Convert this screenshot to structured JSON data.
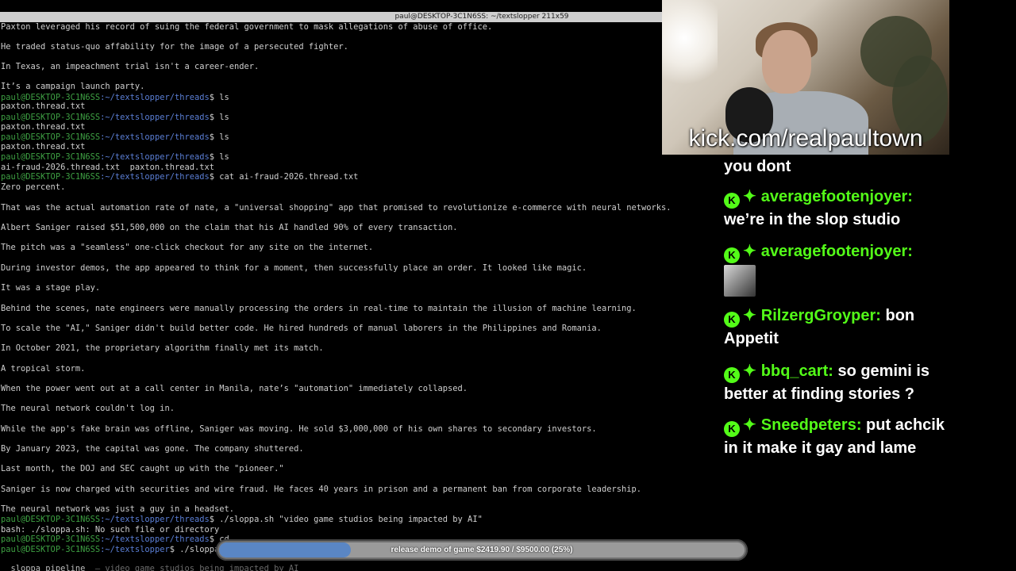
{
  "window": {
    "title": "paul@DESKTOP-3C1N6SS: ~/textslopper 211x59"
  },
  "terminal": {
    "prompt_user": "paul@DESKTOP-3C1N6SS",
    "lines": [
      {
        "type": "text",
        "text": "Paxton leveraged his record of suing the federal government to mask allegations of abuse of office."
      },
      {
        "type": "text",
        "text": "He traded status-quo affability for the image of a persecuted fighter."
      },
      {
        "type": "text",
        "text": "In Texas, an impeachment trial isn't a career-ender."
      },
      {
        "type": "text",
        "text": "It’s a campaign launch party."
      },
      {
        "type": "prompt",
        "path": ":~/textslopper/threads",
        "cmd": "$ ls"
      },
      {
        "type": "text",
        "text": "paxton.thread.txt"
      },
      {
        "type": "prompt",
        "path": ":~/textslopper/threads",
        "cmd": "$ ls"
      },
      {
        "type": "text",
        "text": "paxton.thread.txt"
      },
      {
        "type": "prompt",
        "path": ":~/textslopper/threads",
        "cmd": "$ ls"
      },
      {
        "type": "text",
        "text": "paxton.thread.txt"
      },
      {
        "type": "prompt",
        "path": ":~/textslopper/threads",
        "cmd": "$ ls"
      },
      {
        "type": "text",
        "text": "ai-fraud-2026.thread.txt  paxton.thread.txt"
      },
      {
        "type": "prompt",
        "path": ":~/textslopper/threads",
        "cmd": "$ cat ai-fraud-2026.thread.txt"
      },
      {
        "type": "text",
        "text": "Zero percent."
      },
      {
        "type": "text",
        "text": "That was the actual automation rate of nate, a \"universal shopping\" app that promised to revolutionize e-commerce with neural networks."
      },
      {
        "type": "text",
        "text": "Albert Saniger raised $51,500,000 on the claim that his AI handled 90% of every transaction."
      },
      {
        "type": "text",
        "text": "The pitch was a \"seamless\" one-click checkout for any site on the internet."
      },
      {
        "type": "text",
        "text": "During investor demos, the app appeared to think for a moment, then successfully place an order. It looked like magic."
      },
      {
        "type": "text",
        "text": "It was a stage play."
      },
      {
        "type": "text",
        "text": "Behind the scenes, nate engineers were manually processing the orders in real-time to maintain the illusion of machine learning."
      },
      {
        "type": "text",
        "text": "To scale the \"AI,\" Saniger didn't build better code. He hired hundreds of manual laborers in the Philippines and Romania."
      },
      {
        "type": "text",
        "text": "In October 2021, the proprietary algorithm finally met its match."
      },
      {
        "type": "text",
        "text": "A tropical storm."
      },
      {
        "type": "text",
        "text": "When the power went out at a call center in Manila, nate’s \"automation\" immediately collapsed."
      },
      {
        "type": "text",
        "text": "The neural network couldn't log in."
      },
      {
        "type": "text",
        "text": "While the app's fake brain was offline, Saniger was moving. He sold $3,000,000 of his own shares to secondary investors."
      },
      {
        "type": "text",
        "text": "By January 2023, the capital was gone. The company shuttered."
      },
      {
        "type": "text",
        "text": "Last month, the DOJ and SEC caught up with the \"pioneer.\""
      },
      {
        "type": "text",
        "text": "Saniger is now charged with securities and wire fraud. He faces 40 years in prison and a permanent ban from corporate leadership."
      },
      {
        "type": "text",
        "text": "The neural network was just a guy in a headset."
      },
      {
        "type": "prompt",
        "path": ":~/textslopper/threads",
        "cmd": "$ ./sloppa.sh \"video game studios being impacted by AI\""
      },
      {
        "type": "text",
        "text": "bash: ./sloppa.sh: No such file or directory"
      },
      {
        "type": "prompt",
        "path": ":~/textslopper/threads",
        "cmd": "$ cd .."
      },
      {
        "type": "prompt",
        "path": ":~/textslopper",
        "cmd": "$ ./sloppa"
      },
      {
        "type": "pipeline",
        "text": "  sloppa_pipeline",
        "dim": "  — video game studios being impacted by AI"
      }
    ]
  },
  "overlay": {
    "kick_url": "kick.com/realpaultown"
  },
  "chat": {
    "badge_icon": "kick-icon",
    "sub_icon": "sparkle-icon",
    "colors": {
      "user": "#53fc18"
    },
    "messages": [
      {
        "user": "",
        "text": "you dont",
        "partial": true
      },
      {
        "user": "averagefootenjoyer:",
        "text": "we’re in the slop studio"
      },
      {
        "user": "averagefootenjoyer:",
        "text": "",
        "emote": "emote-image"
      },
      {
        "user": "RilzergGroyper:",
        "text": "bon Appetit"
      },
      {
        "user": "bbq_cart:",
        "text": "so gemini is better at finding stories ?"
      },
      {
        "user": "Sneedpeters:",
        "text": "put achcik in it make it gay and lame"
      }
    ]
  },
  "goal": {
    "label": "release demo of game $2419.90 / $9500.00 (25%)",
    "progress": 0.25,
    "fill_color": "#5a86c4"
  }
}
